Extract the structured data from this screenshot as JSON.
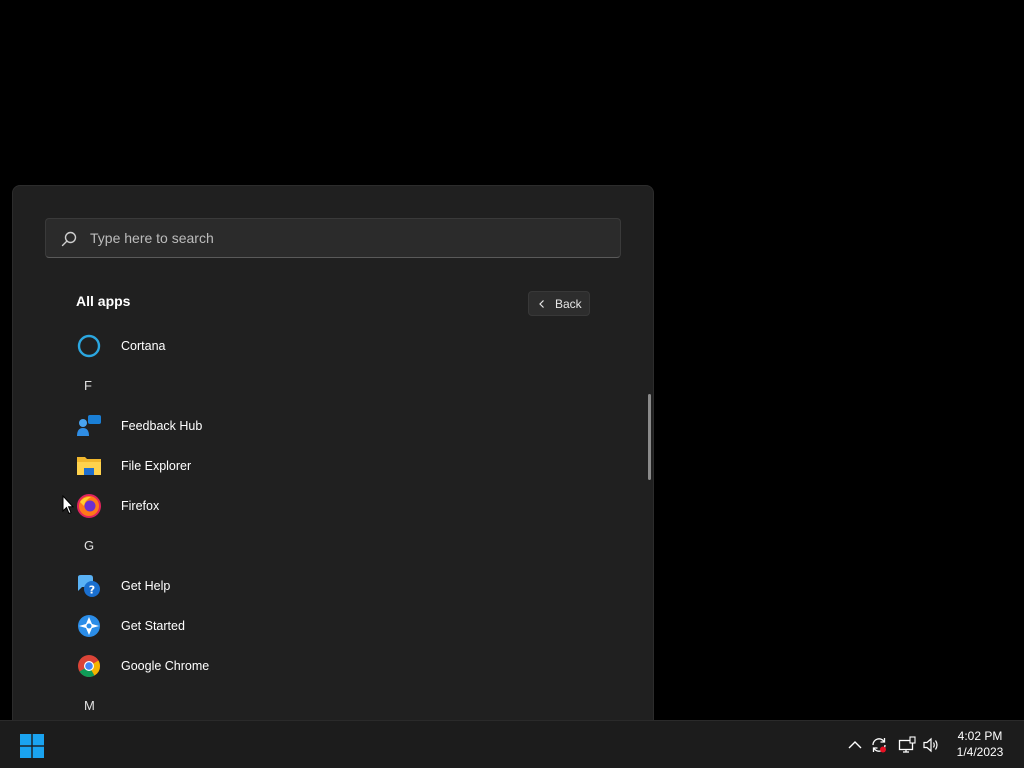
{
  "search": {
    "placeholder": "Type here to search"
  },
  "all_apps": {
    "title": "All apps",
    "back_label": "Back"
  },
  "apps": [
    {
      "type": "app",
      "label": "Cortana",
      "icon": "cortana-icon"
    },
    {
      "type": "letter",
      "label": "F"
    },
    {
      "type": "app",
      "label": "Feedback Hub",
      "icon": "feedback-hub-icon"
    },
    {
      "type": "app",
      "label": "File Explorer",
      "icon": "file-explorer-icon"
    },
    {
      "type": "app",
      "label": "Firefox",
      "icon": "firefox-icon"
    },
    {
      "type": "letter",
      "label": "G"
    },
    {
      "type": "app",
      "label": "Get Help",
      "icon": "get-help-icon"
    },
    {
      "type": "app",
      "label": "Get Started",
      "icon": "get-started-icon"
    },
    {
      "type": "app",
      "label": "Google Chrome",
      "icon": "chrome-icon"
    },
    {
      "type": "letter",
      "label": "M"
    }
  ],
  "taskbar": {
    "clock": {
      "time": "4:02 PM",
      "date": "1/4/2023"
    },
    "tray_icons": [
      "chevron-up-icon",
      "sync-icon",
      "network-icon",
      "volume-icon"
    ]
  },
  "colors": {
    "accent": "#0078d4",
    "menu_bg": "#202020",
    "taskbar_bg": "#1c1c1c"
  }
}
